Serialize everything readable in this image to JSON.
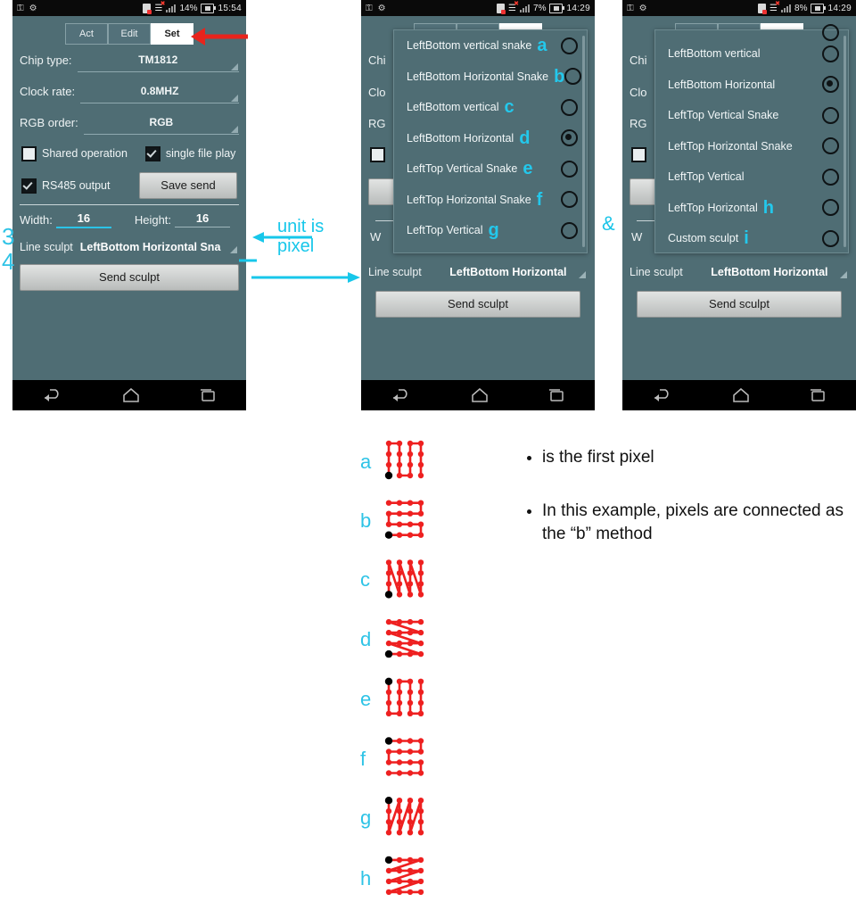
{
  "phones": [
    {
      "id": "phone-left",
      "status": {
        "battery": "14%",
        "time": "15:54"
      },
      "tabs": [
        {
          "label": "Act",
          "active": false
        },
        {
          "label": "Edit",
          "active": false
        },
        {
          "label": "Set",
          "active": true
        }
      ],
      "fields": [
        {
          "label": "Chip type:",
          "value": "TM1812"
        },
        {
          "label": "Clock rate:",
          "value": "0.8MHZ"
        },
        {
          "label": "RGB order:",
          "value": "RGB"
        }
      ],
      "checkboxes": [
        {
          "label": "Shared operation",
          "checked": false
        },
        {
          "label": "single file play",
          "checked": true
        },
        {
          "label": "RS485 output",
          "checked": true
        }
      ],
      "save_label": "Save send",
      "width_label": "Width:",
      "width_value": "16",
      "height_label": "Height:",
      "height_value": "16",
      "line_sculpt_label": "Line sculpt",
      "line_sculpt_value": "LeftBottom Horizontal Sna",
      "send_label": "Send sculpt"
    },
    {
      "id": "phone-middle",
      "status": {
        "battery": "7%",
        "time": "14:29"
      },
      "behind_labels": [
        "Chi",
        "Clo",
        "RG"
      ],
      "line_sculpt_label": "Line sculpt",
      "line_sculpt_value": "LeftBottom Horizontal",
      "send_label": "Send sculpt",
      "dropdown": [
        {
          "text": "LeftBottom vertical snake",
          "mark": "a",
          "selected": false
        },
        {
          "text": "LeftBottom Horizontal Snake",
          "mark": "b",
          "selected": false
        },
        {
          "text": "LeftBottom vertical",
          "mark": "c",
          "selected": false
        },
        {
          "text": "LeftBottom Horizontal",
          "mark": "d",
          "selected": true
        },
        {
          "text": "LeftTop Vertical Snake",
          "mark": "e",
          "selected": false
        },
        {
          "text": "LeftTop Horizontal Snake",
          "mark": "f",
          "selected": false
        },
        {
          "text": "LeftTop Vertical",
          "mark": "g",
          "selected": false
        }
      ]
    },
    {
      "id": "phone-right",
      "status": {
        "battery": "8%",
        "time": "14:29"
      },
      "behind_labels": [
        "Chi",
        "Clo",
        "RG"
      ],
      "line_sculpt_label": "Line sculpt",
      "line_sculpt_value": "LeftBottom Horizontal",
      "send_label": "Send sculpt",
      "dropdown": [
        {
          "text": "LeftBottom vertical",
          "mark": "",
          "selected": false
        },
        {
          "text": "LeftBottom Horizontal",
          "mark": "",
          "selected": true
        },
        {
          "text": "LeftTop Vertical Snake",
          "mark": "",
          "selected": false
        },
        {
          "text": "LeftTop Horizontal Snake",
          "mark": "",
          "selected": false
        },
        {
          "text": "LeftTop Vertical",
          "mark": "",
          "selected": false
        },
        {
          "text": "LeftTop Horizontal",
          "mark": "h",
          "selected": false
        },
        {
          "text": "Custom sculpt",
          "mark": "i",
          "selected": false
        }
      ]
    }
  ],
  "annotations": {
    "step3": "3",
    "step4": "4",
    "ampersand": "&",
    "unit_note": "unit is pixel",
    "unit_line1": "unit is",
    "unit_line2": "pixel",
    "accent_color": "#17c7ea",
    "arrow_color": "#e8241c"
  },
  "diagram": {
    "labels": [
      "a",
      "b",
      "c",
      "d",
      "e",
      "f",
      "g",
      "h"
    ],
    "patterns": [
      {
        "label": "a",
        "start": "bottom-left",
        "axis": "vertical",
        "snake": true
      },
      {
        "label": "b",
        "start": "bottom-left",
        "axis": "horizontal",
        "snake": true
      },
      {
        "label": "c",
        "start": "bottom-left",
        "axis": "vertical",
        "snake": false
      },
      {
        "label": "d",
        "start": "bottom-left",
        "axis": "horizontal",
        "snake": false
      },
      {
        "label": "e",
        "start": "top-left",
        "axis": "vertical",
        "snake": true
      },
      {
        "label": "f",
        "start": "top-left",
        "axis": "horizontal",
        "snake": true
      },
      {
        "label": "g",
        "start": "top-left",
        "axis": "vertical",
        "snake": false
      },
      {
        "label": "h",
        "start": "top-left",
        "axis": "horizontal",
        "snake": false
      }
    ],
    "grid": {
      "cols": 4,
      "rows": 4
    },
    "dot_color": "#ee2020",
    "first_pixel_color": "#000000",
    "bullets": [
      "is the first pixel",
      "In this example, pixels are connected as the “b” method"
    ]
  }
}
